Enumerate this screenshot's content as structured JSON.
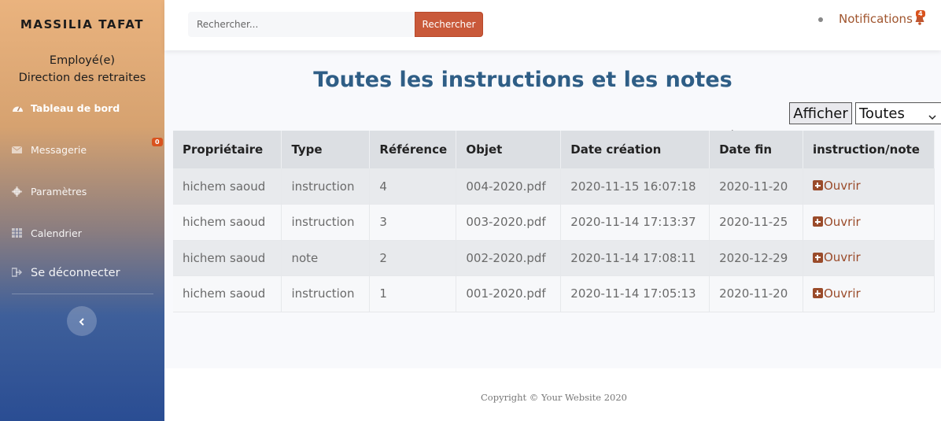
{
  "sidebar": {
    "brand": "MASSILIA TAFAT",
    "role_line1": "Employé(e)",
    "role_line2": "Direction des retraites",
    "items": [
      {
        "label": "Tableau de bord",
        "icon": "dashboard-icon"
      },
      {
        "label": "Messagerie",
        "icon": "envelope-icon",
        "badge": "0"
      },
      {
        "label": "Paramètres",
        "icon": "gear-icon"
      },
      {
        "label": "Calendrier",
        "icon": "calendar-icon"
      },
      {
        "label": "Se déconnecter",
        "icon": "logout-icon"
      }
    ],
    "toggle_icon": "chevron-left-icon"
  },
  "topbar": {
    "search_placeholder": "Rechercher...",
    "search_button": "Rechercher",
    "notifications_label": "Notifications",
    "notifications_count": "4"
  },
  "main": {
    "title": "Toutes les instructions et les notes",
    "afficher_button": "Afficher",
    "filter_value": "Toutes",
    "table": {
      "headers": [
        "Propriétaire",
        "Type",
        "Référence",
        "Objet",
        "Date création",
        "Date fin",
        "instruction/note"
      ],
      "rows": [
        {
          "owner": "hichem saoud",
          "type": "instruction",
          "ref": "4",
          "objet": "004-2020.pdf",
          "created": "2020-11-15 16:07:18",
          "end": "2020-11-20",
          "action": "Ouvrir"
        },
        {
          "owner": "hichem saoud",
          "type": "instruction",
          "ref": "3",
          "objet": "003-2020.pdf",
          "created": "2020-11-14 17:13:37",
          "end": "2020-11-25",
          "action": "Ouvrir"
        },
        {
          "owner": "hichem saoud",
          "type": "note",
          "ref": "2",
          "objet": "002-2020.pdf",
          "created": "2020-11-14 17:08:11",
          "end": "2020-12-29",
          "action": "Ouvrir"
        },
        {
          "owner": "hichem saoud",
          "type": "instruction",
          "ref": "1",
          "objet": "001-2020.pdf",
          "created": "2020-11-14 17:05:13",
          "end": "2020-11-20",
          "action": "Ouvrir"
        }
      ]
    }
  },
  "footer": {
    "copyright": "Copyright © Your Website 2020"
  },
  "colors": {
    "accent": "#c9593a",
    "title": "#2f5e86",
    "link": "#9a4b2a"
  }
}
